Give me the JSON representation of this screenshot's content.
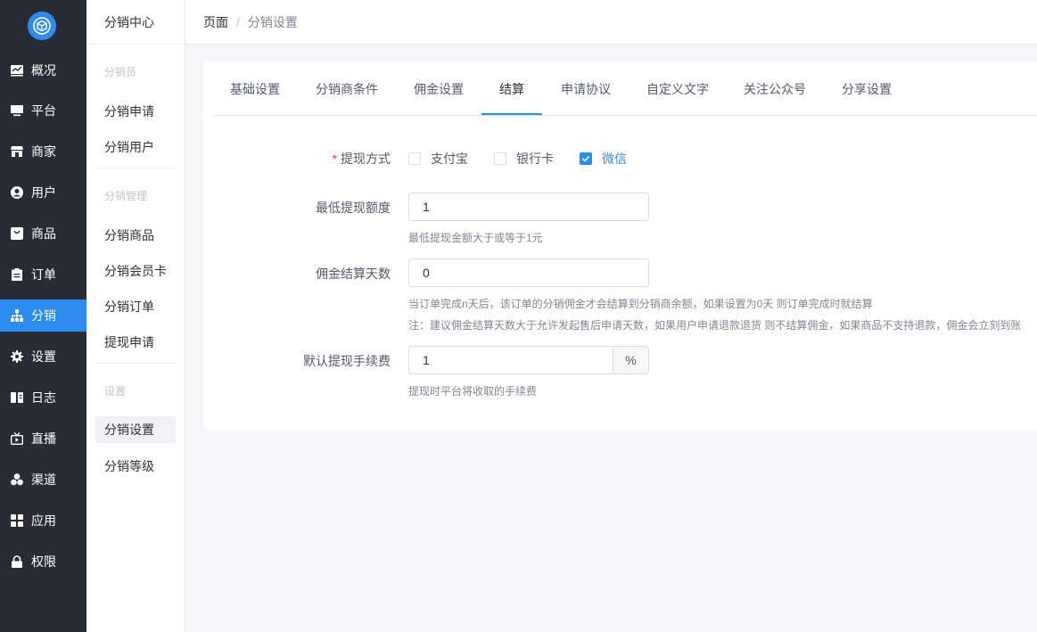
{
  "sidebar": {
    "items": [
      {
        "label": "概况",
        "icon": "chart-icon"
      },
      {
        "label": "平台",
        "icon": "monitor-icon"
      },
      {
        "label": "商家",
        "icon": "store-icon"
      },
      {
        "label": "用户",
        "icon": "user-icon"
      },
      {
        "label": "商品",
        "icon": "bag-icon"
      },
      {
        "label": "订单",
        "icon": "clipboard-icon"
      },
      {
        "label": "分销",
        "icon": "sitemap-icon"
      },
      {
        "label": "设置",
        "icon": "gear-icon"
      },
      {
        "label": "日志",
        "icon": "book-icon"
      },
      {
        "label": "直播",
        "icon": "tv-icon"
      },
      {
        "label": "渠道",
        "icon": "cubes-icon"
      },
      {
        "label": "应用",
        "icon": "grid-icon"
      },
      {
        "label": "权限",
        "icon": "lock-icon"
      }
    ],
    "accent": "#2d8cf0"
  },
  "submenu": {
    "title": "分销中心",
    "group_distributor": "分销员",
    "apply": "分销申请",
    "users": "分销用户",
    "group_manage": "分销管理",
    "goods": "分销商品",
    "member_card": "分销会员卡",
    "orders": "分销订单",
    "withdraw_apply": "提现申请",
    "group_settings": "设置",
    "settings": "分销设置",
    "levels": "分销等级"
  },
  "breadcrumb": {
    "home": "页面",
    "separator": "/",
    "current": "分销设置"
  },
  "tabs": [
    {
      "label": "基础设置"
    },
    {
      "label": "分销商条件"
    },
    {
      "label": "佣金设置"
    },
    {
      "label": "结算"
    },
    {
      "label": "申请协议"
    },
    {
      "label": "自定义文字"
    },
    {
      "label": "关注公众号"
    },
    {
      "label": "分享设置"
    }
  ],
  "form": {
    "withdraw_method": {
      "required_mark": "*",
      "label": "提现方式",
      "options": [
        {
          "label": "支付宝",
          "checked": false
        },
        {
          "label": "银行卡",
          "checked": false
        },
        {
          "label": "微信",
          "checked": true
        }
      ]
    },
    "min_withdraw": {
      "label": "最低提现额度",
      "value": "1",
      "help": "最低提现金额大于或等于1元"
    },
    "settle_days": {
      "label": "佣金结算天数",
      "value": "0",
      "help1": "当订单完成n天后，该订单的分销佣金才会结算到分销商余额，如果设置为0天 则订单完成时就结算",
      "help2": "注：建议佣金结算天数大于允许发起售后申请天数，如果用户申请退款退货 则不结算佣金，如果商品不支持退款，佣金会立刻到账"
    },
    "fee": {
      "label": "默认提现手续费",
      "value": "1",
      "unit": "%",
      "help": "提现时平台将收取的手续费"
    }
  }
}
